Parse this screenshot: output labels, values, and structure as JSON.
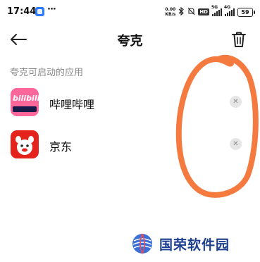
{
  "status_bar": {
    "time": "17:44",
    "dots": "···",
    "speed_value": "0.00",
    "speed_unit": "KB/s",
    "hd_badge": "HD",
    "signal1_label": "5G",
    "signal2_label": "4G",
    "battery": "59"
  },
  "header": {
    "title": "夸克"
  },
  "section": {
    "label": "夸克可启动的应用"
  },
  "apps": [
    {
      "name": "哔哩哔哩",
      "icon": "bilibili-icon",
      "icon_text": "bilibili"
    },
    {
      "name": "京东",
      "icon": "jd-icon"
    }
  ],
  "watermark": {
    "text": "国荣软件园"
  },
  "colors": {
    "annotation": "#f47a40",
    "bilibili": "#ff6699",
    "jd": "#e4231d",
    "watermark": "#1c3f8f"
  }
}
